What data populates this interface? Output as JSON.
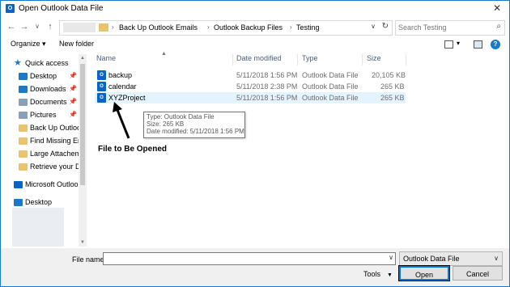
{
  "window": {
    "title": "Open Outlook Data File",
    "close_glyph": "✕"
  },
  "nav": {
    "back_glyph": "←",
    "forward_glyph": "→",
    "recent_glyph": "∨",
    "up_glyph": "↑",
    "breadcrumbs": [
      "Back Up Outlook Emails",
      "Outlook Backup Files",
      "Testing"
    ],
    "crumb_sep": "›",
    "search_placeholder": "Search Testing"
  },
  "toolbar": {
    "organize": "Organize ▾",
    "new_folder": "New folder",
    "view_dd": "▾",
    "help": "?"
  },
  "sidebar": {
    "items": [
      {
        "label": "Quick access",
        "icon": "star-icon",
        "color": "#1979ca",
        "pinned": false
      },
      {
        "label": "Desktop",
        "icon": "desktop-icon",
        "color": "#1979ca",
        "pinned": true
      },
      {
        "label": "Downloads",
        "icon": "downloads-icon",
        "color": "#1979ca",
        "pinned": true
      },
      {
        "label": "Documents",
        "icon": "documents-icon",
        "color": "#8aa0b8",
        "pinned": true
      },
      {
        "label": "Pictures",
        "icon": "pictures-icon",
        "color": "#8aa0b8",
        "pinned": true
      },
      {
        "label": "Back Up Outlook",
        "icon": "folder-icon",
        "color": "#e9c46a",
        "pinned": false
      },
      {
        "label": "Find Missing Em",
        "icon": "folder-icon",
        "color": "#e9c46a",
        "pinned": false
      },
      {
        "label": "Large Attacheme",
        "icon": "folder-icon",
        "color": "#e9c46a",
        "pinned": false
      },
      {
        "label": "Retrieve your De",
        "icon": "folder-icon",
        "color": "#e9c46a",
        "pinned": false
      },
      {
        "label": "Microsoft Outlook",
        "icon": "outlook-icon",
        "color": "#0a64c8",
        "pinned": false
      },
      {
        "label": "Desktop",
        "icon": "desktop-icon",
        "color": "#1979ca",
        "pinned": false
      }
    ],
    "pin_glyph": "📌"
  },
  "columns": {
    "name": "Name",
    "date": "Date modified",
    "type": "Type",
    "size": "Size"
  },
  "files": [
    {
      "name": "backup",
      "date": "5/11/2018 1:56 PM",
      "type": "Outlook Data File",
      "size": "20,105 KB",
      "selected": false
    },
    {
      "name": "calendar",
      "date": "5/11/2018 2:38 PM",
      "type": "Outlook Data File",
      "size": "265 KB",
      "selected": false
    },
    {
      "name": "XYZProject",
      "date": "5/11/2018 1:56 PM",
      "type": "Outlook Data File",
      "size": "265 KB",
      "selected": true
    }
  ],
  "tooltip": {
    "type": "Type: Outlook Data File",
    "size": "Size: 265 KB",
    "date": "Date modified: 5/11/2018 1:56 PM"
  },
  "annotation": "File to Be Opened",
  "bottom": {
    "file_name_label": "File name:",
    "file_name_value": "",
    "file_type": "Outlook Data File",
    "tools": "Tools",
    "open": "Open",
    "cancel": "Cancel"
  },
  "colors": {
    "accent": "#1979ca",
    "selected_row": "#e5f3ff",
    "outlook_blue": "#0a64c8"
  }
}
